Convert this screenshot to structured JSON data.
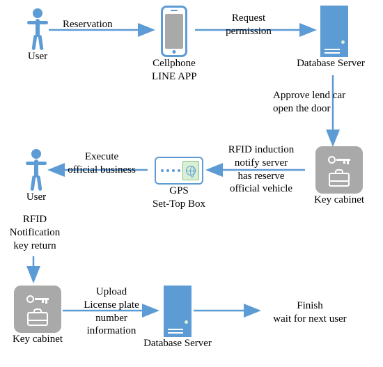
{
  "nodes": {
    "user1": "User",
    "phone": {
      "l1": "Cellphone",
      "l2": "LINE APP"
    },
    "server1": "Database Server",
    "cabinet1": "Key cabinet",
    "gps": {
      "l1": "GPS",
      "l2": "Set-Top Box"
    },
    "user2": "User",
    "user2_sub": {
      "l1": "RFID",
      "l2": "Notification",
      "l3": "key return"
    },
    "cabinet2": "Key cabinet",
    "server2": "Database Server",
    "finish": {
      "l1": "Finish",
      "l2": "wait for next user"
    }
  },
  "edges": {
    "reservation": "Reservation",
    "request": {
      "l1": "Request",
      "l2": "permission"
    },
    "approve": {
      "l1": "Approve lend car",
      "l2": "open the door"
    },
    "rfid": {
      "l1": "RFID induction",
      "l2": "notify server",
      "l3": "has reserve",
      "l4": "official vehicle"
    },
    "execute": {
      "l1": "Execute",
      "l2": "official business"
    },
    "upload": {
      "l1": "Upload",
      "l2": "License plate",
      "l3": "number",
      "l4": "information"
    }
  }
}
